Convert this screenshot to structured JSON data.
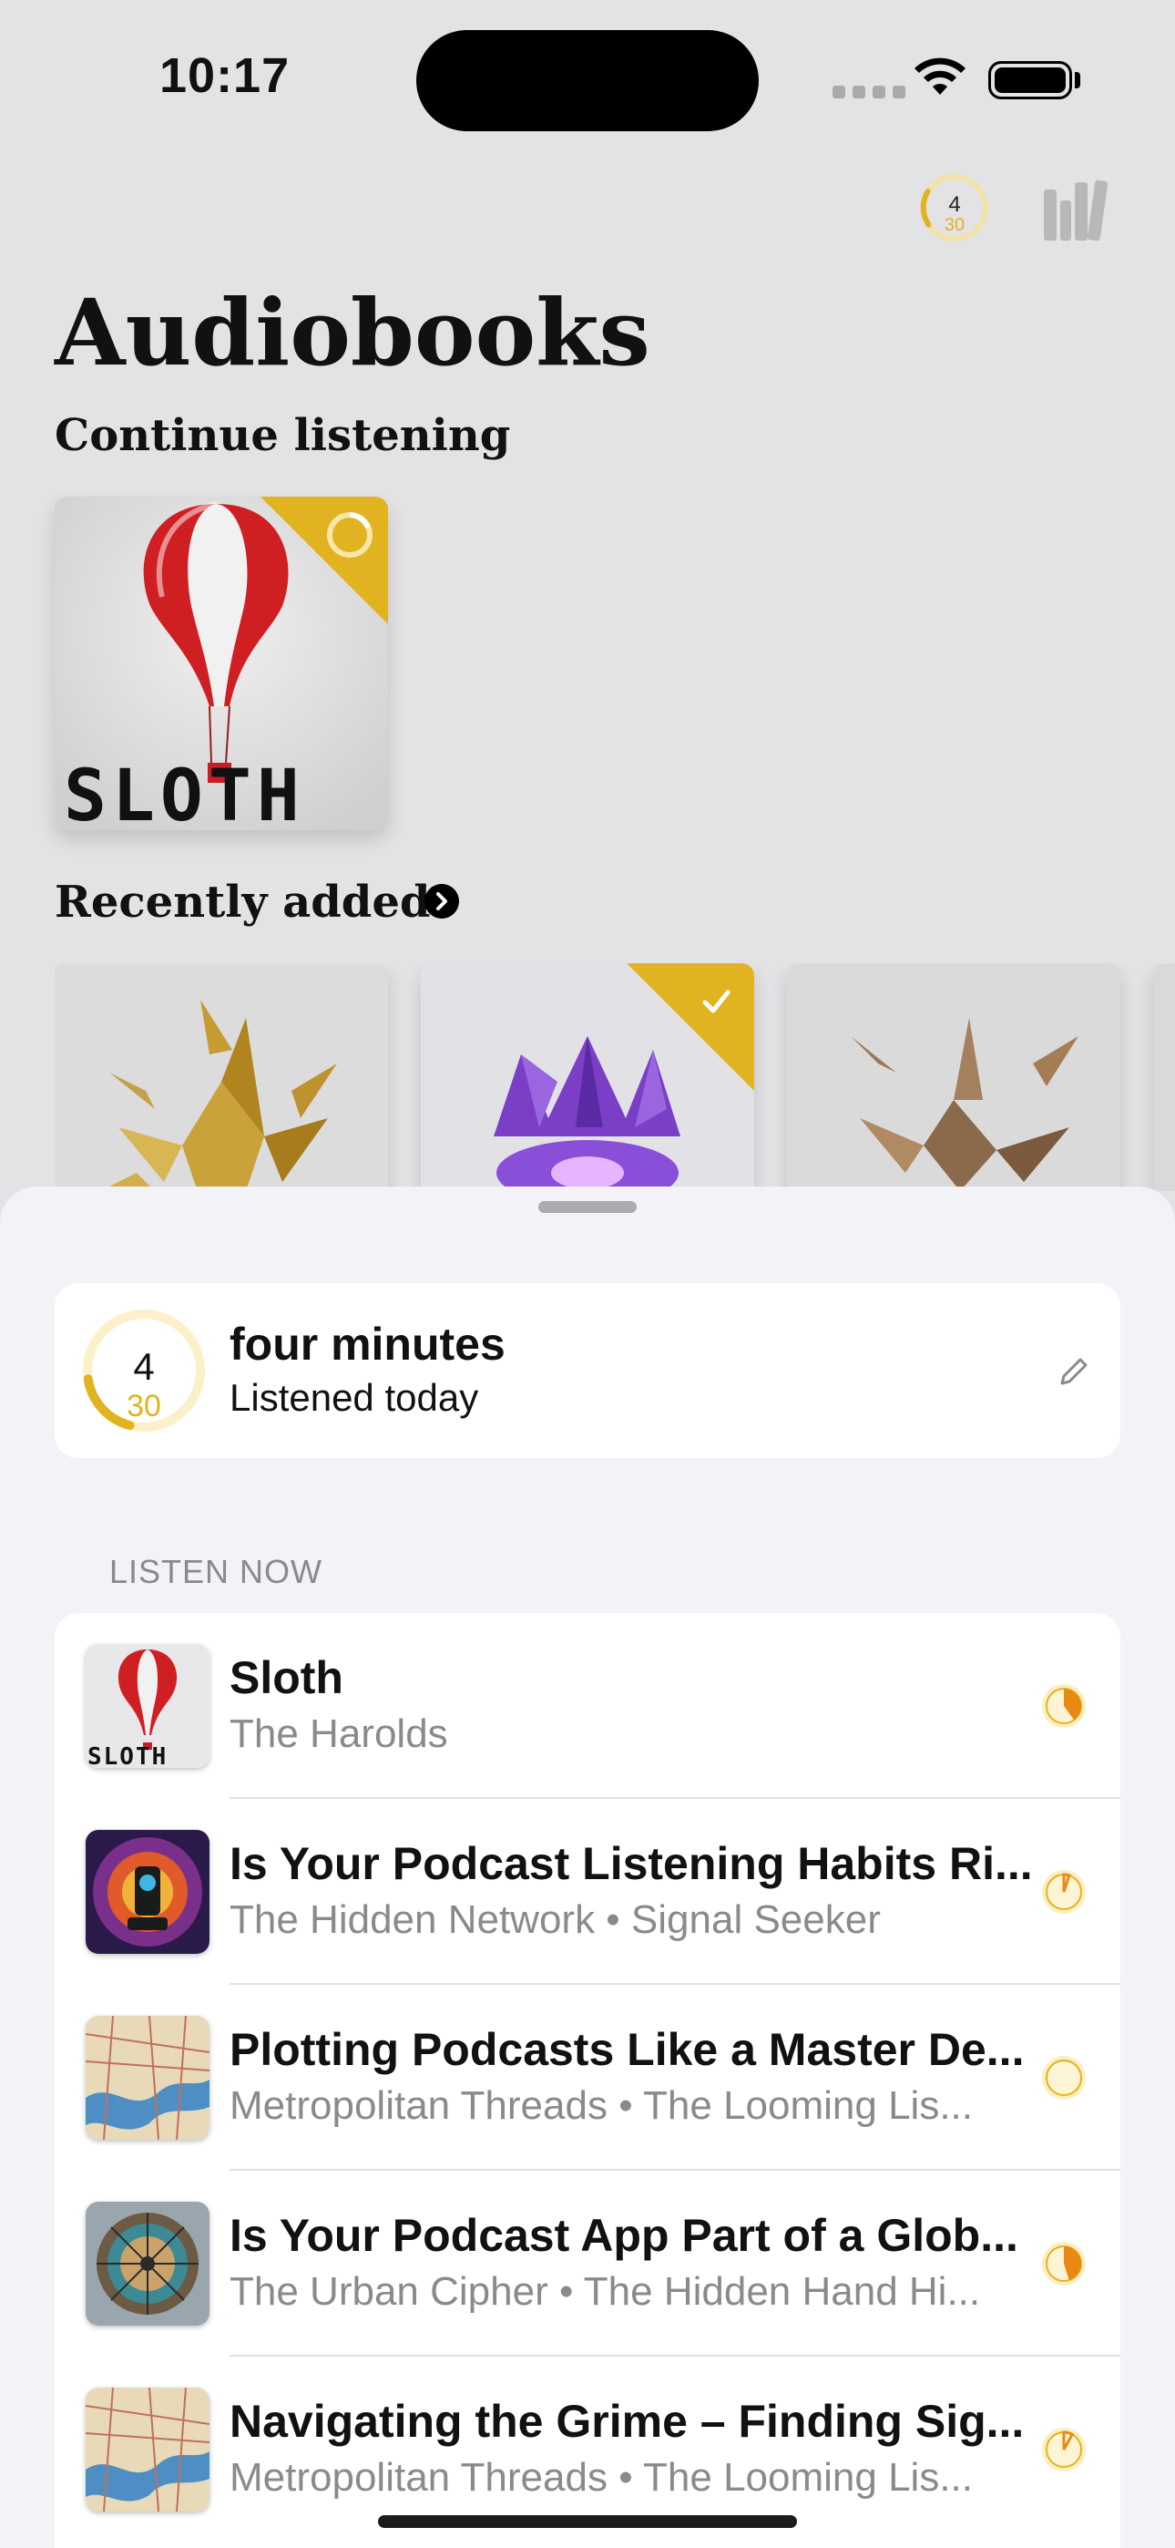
{
  "status_bar": {
    "time": "10:17"
  },
  "header": {
    "goal_listened": "4",
    "goal_target": "30"
  },
  "page_title": "Audiobooks",
  "sections": {
    "continue": "Continue listening",
    "recent": "Recently added"
  },
  "continue_book": {
    "cover_text": "SLOTH"
  },
  "stats": {
    "value": "four minutes",
    "label": "Listened today",
    "ring_current": "4",
    "ring_goal": "30",
    "ring_progress": 0.133
  },
  "listen_now": {
    "header": "LISTEN NOW",
    "items": [
      {
        "title": "Sloth",
        "subtitle": "The Harolds",
        "art_text": "SLOTH",
        "progress": 0.4
      },
      {
        "title": "Is Your Podcast Listening Habits Ri...",
        "subtitle": "The Hidden Network • Signal Seeker",
        "progress": 0.05
      },
      {
        "title": "Plotting Podcasts Like a Master De...",
        "subtitle": "Metropolitan Threads • The Looming Lis...",
        "progress": 0.0
      },
      {
        "title": "Is Your Podcast App Part of a Glob...",
        "subtitle": "The Urban Cipher • The Hidden Hand Hi...",
        "progress": 0.45
      },
      {
        "title": "Navigating the Grime – Finding Sig...",
        "subtitle": "Metropolitan Threads • The Looming Lis...",
        "progress": 0.08
      }
    ]
  },
  "colors": {
    "accent": "#e1b321",
    "sheet": "#f2f2f7",
    "background": "#e3e3e6"
  }
}
